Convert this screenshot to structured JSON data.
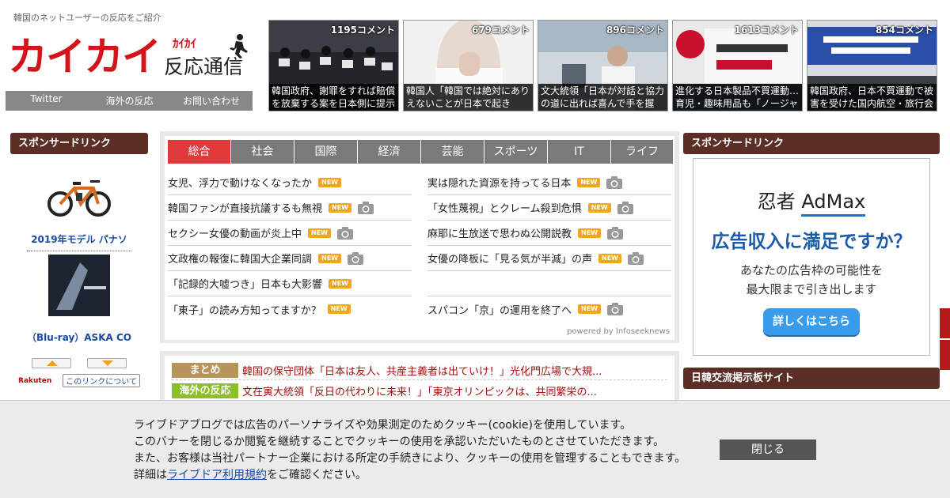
{
  "header": {
    "tagline": "韓国のネットユーザーの反応をご紹介",
    "logo_main": "カイカイ",
    "logo_kana": "ｶｲｶｲ",
    "logo_sub": "反応通信",
    "nav": [
      "Twitter",
      "海外の反応",
      "お問い合わせ"
    ]
  },
  "thumbs": [
    {
      "count": "1195コメント",
      "caption": "韓国政府、謝罪をすれば賠償を放棄する案を日本側に提示"
    },
    {
      "count": "679コメント",
      "caption": "韓国人「韓国では絶対にありえないことが日本で起き"
    },
    {
      "count": "896コメント",
      "caption": "文大統領「日本が対話と協力の道に出れば喜んで手を握"
    },
    {
      "count": "1613コメント",
      "caption": "進化する日本製品不買運動…育児・趣味用品も「ノージャ"
    },
    {
      "count": "854コメント",
      "caption": "韓国政府、日本不買運動で被害を受けた国内航空・旅行会"
    }
  ],
  "left": {
    "heading": "スポンサードリンク",
    "product1_title": "2019年モデル パナソ",
    "product2_title": "（Blu-ray）ASKA CO",
    "rakuten": "Rakuten",
    "about": "このリンクについて"
  },
  "news": {
    "tabs": [
      "総合",
      "社会",
      "国際",
      "経済",
      "芸能",
      "スポーツ",
      "IT",
      "ライフ"
    ],
    "badge": "NEW",
    "col1": [
      {
        "title": "女児、浮力で動けなくなったか",
        "camera": false
      },
      {
        "title": "韓国ファンが直接抗議するも無視",
        "camera": true
      },
      {
        "title": "セクシー女優の動画が炎上中",
        "camera": true
      },
      {
        "title": "文政権の報復に韓国大企業同調",
        "camera": true
      },
      {
        "title": "「記録的大嘘つき」日本も大影響",
        "camera": false
      },
      {
        "title": "「東子」の読み方知ってますか？",
        "camera": false
      }
    ],
    "col2": [
      {
        "title": "実は隠れた資源を持ってる日本",
        "camera": true
      },
      {
        "title": "「女性蔑視」とクレーム殺到危惧",
        "camera": true
      },
      {
        "title": "麻耶に生放送で思わぬ公開説教",
        "camera": true
      },
      {
        "title": "女優の降板に「見る気が半減」の声",
        "camera": true
      },
      {
        "title": "",
        "camera": false
      },
      {
        "title": "スパコン「京」の運用を終了へ",
        "camera": true
      }
    ],
    "powered": "powered by Infoseeknews"
  },
  "summary": [
    {
      "tag": "まとめ",
      "color": "#b8935a",
      "text": "韓国の保守団体「日本は友人、共産主義者は出ていけ！」光化門広場で大規..."
    },
    {
      "tag": "海外の反応",
      "color": "#8cbf2a",
      "text": "文在寅大統領「反日の代わりに未来！」「東京オリンピックは、共同繁栄の..."
    }
  ],
  "right": {
    "heading1": "スポンサードリンク",
    "heading2": "日韓交流掲示板サイト",
    "ad_brand_a": "忍者",
    "ad_brand_b": "AdMax",
    "ad_headline": "広告収入に満足ですか？",
    "ad_sub1": "あなたの広告枠の可能性を",
    "ad_sub2": "最大限まで引き出します",
    "ad_button": "詳しくはこちら"
  },
  "cookie": {
    "line1": "ライブドアブログでは広告のパーソナライズや効果測定のためクッキー(cookie)を使用しています。",
    "line2": "このバナーを閉じるか閲覧を継続することでクッキーの使用を承認いただいたものとさせていただきます。",
    "line3": "また、お客様は当社パートナー企業における所定の手続きにより、クッキーの使用を管理することもできます。",
    "line4_pre": "詳細は",
    "line4_link": "ライブドア利用規約",
    "line4_post": "をご確認ください。",
    "close": "閉じる"
  }
}
